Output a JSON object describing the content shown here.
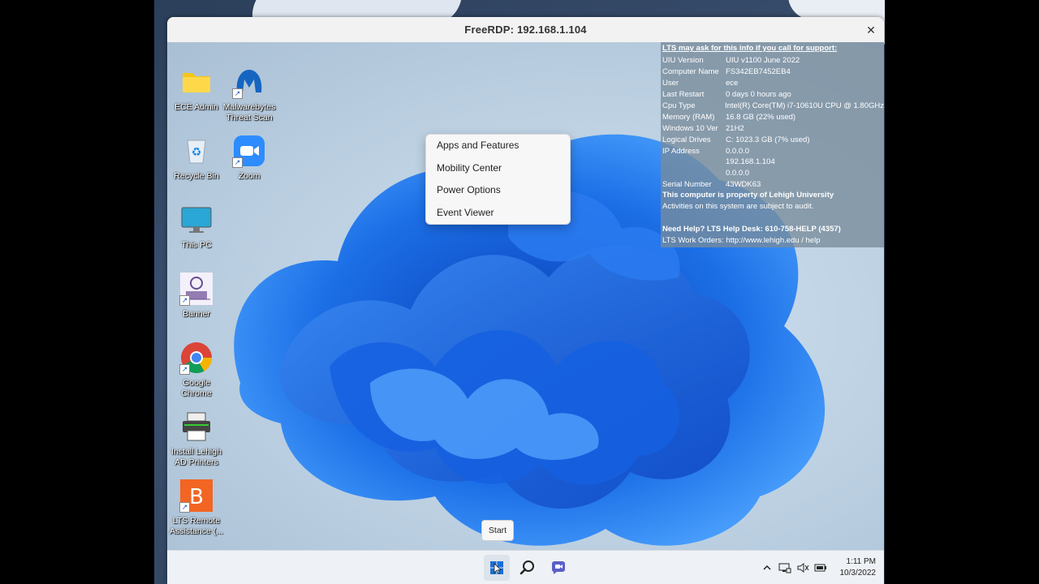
{
  "window": {
    "title": "FreeRDP: 192.168.1.104",
    "close_glyph": "✕"
  },
  "desktop_icons": [
    {
      "label": "ECE Admin",
      "icon": "folder-icon"
    },
    {
      "label": "Malwarebytes Threat Scan",
      "icon": "malwarebytes-icon"
    },
    {
      "label": "Recycle Bin",
      "icon": "recycle-bin-icon"
    },
    {
      "label": "Zoom",
      "icon": "zoom-icon"
    },
    {
      "label": "This PC",
      "icon": "monitor-icon"
    },
    {
      "label": "Banner",
      "icon": "banner-icon"
    },
    {
      "label": "Google Chrome",
      "icon": "chrome-icon"
    },
    {
      "label": "Install Lehigh AD Printers",
      "icon": "printer-icon"
    },
    {
      "label": "LTS Remote Assistance (...",
      "icon": "bomgar-icon"
    }
  ],
  "info_panel": {
    "header": "LTS may ask for this info if you call for support:",
    "rows": [
      {
        "key": "UIU Version",
        "value": "UIU v1100 June 2022"
      },
      {
        "key": "Computer Name",
        "value": "FS342EB7452EB4"
      },
      {
        "key": "User",
        "value": "ece"
      },
      {
        "key": "Last Restart",
        "value": "0 days 0 hours ago"
      },
      {
        "key": "Cpu Type",
        "value": "Intel(R) Core(TM) i7-10610U CPU @ 1.80GHz"
      },
      {
        "key": "Memory (RAM)",
        "value": "16.8 GB (22% used)"
      },
      {
        "key": "Windows 10 Ver",
        "value": "21H2"
      },
      {
        "key": "Logical Drives",
        "value": "C: 1023.3 GB (7% used)"
      },
      {
        "key": "IP Address",
        "value": "0.0.0.0"
      },
      {
        "key": "",
        "value": "192.168.1.104"
      },
      {
        "key": "",
        "value": "0.0.0.0"
      },
      {
        "key": "Serial Number",
        "value": "43WDK63"
      }
    ],
    "property_notice": "This computer is property of Lehigh University",
    "audit_notice": "Activities on this system are subject to audit.",
    "help_line": "Need Help? LTS Help Desk: 610-758-HELP (4357)",
    "work_orders": "LTS Work Orders: http://www.lehigh.edu / help"
  },
  "context_menu": {
    "items": [
      "Apps and Features",
      "Mobility Center",
      "Power Options",
      "Event Viewer"
    ]
  },
  "tooltip": {
    "text": "Start"
  },
  "taskbar": {
    "buttons": [
      "start-icon",
      "search-icon",
      "chat-icon"
    ],
    "tray_icons": [
      "chevron-up-icon",
      "network-icon",
      "volume-icon",
      "battery-icon"
    ],
    "time": "1:11 PM",
    "date": "10/3/2022"
  },
  "colors": {
    "accent": "#1a6fd6",
    "wallpaper_bloom": "#1f6fe0",
    "info_panel_bg": "#788c9b"
  }
}
